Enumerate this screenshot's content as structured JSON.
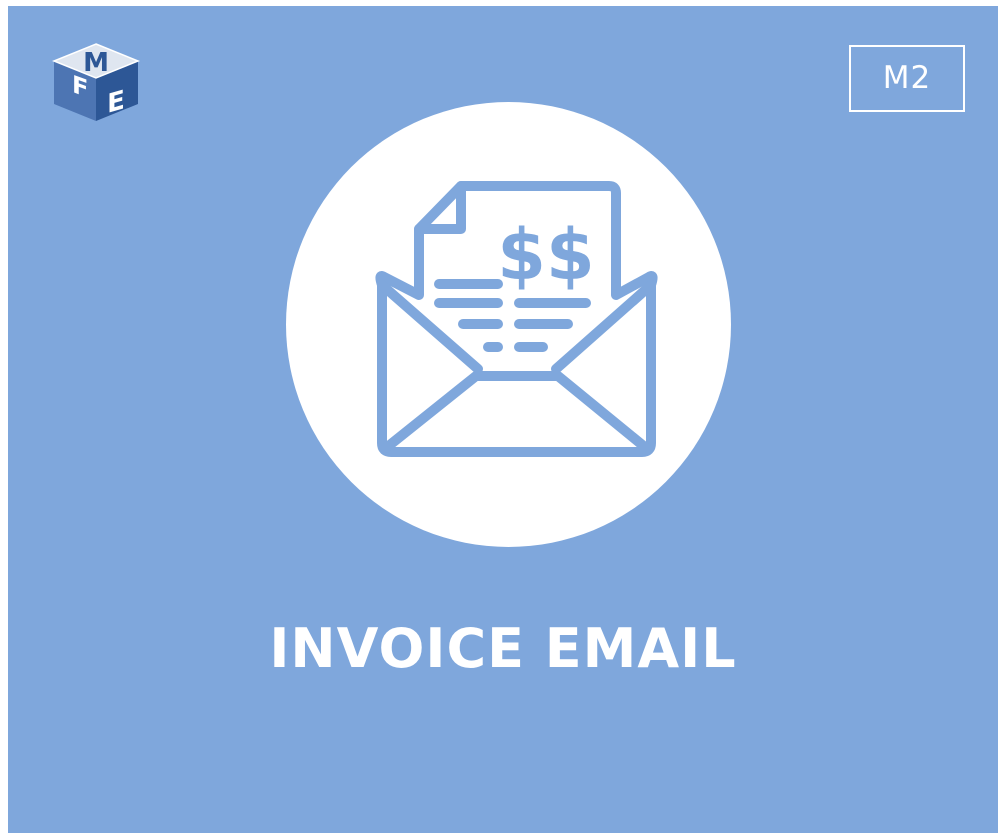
{
  "colors": {
    "background": "#7fa7dc",
    "circle": "#ffffff",
    "icon_stroke": "#7fa7dc",
    "text": "#ffffff"
  },
  "logo": {
    "icon": "fme-cube-logo-icon",
    "letters": [
      "F",
      "M",
      "E"
    ]
  },
  "badge": {
    "label": "M2"
  },
  "hero": {
    "icon": "invoice-envelope-icon",
    "symbol": "$$"
  },
  "title": {
    "text": "INVOICE EMAIL"
  }
}
